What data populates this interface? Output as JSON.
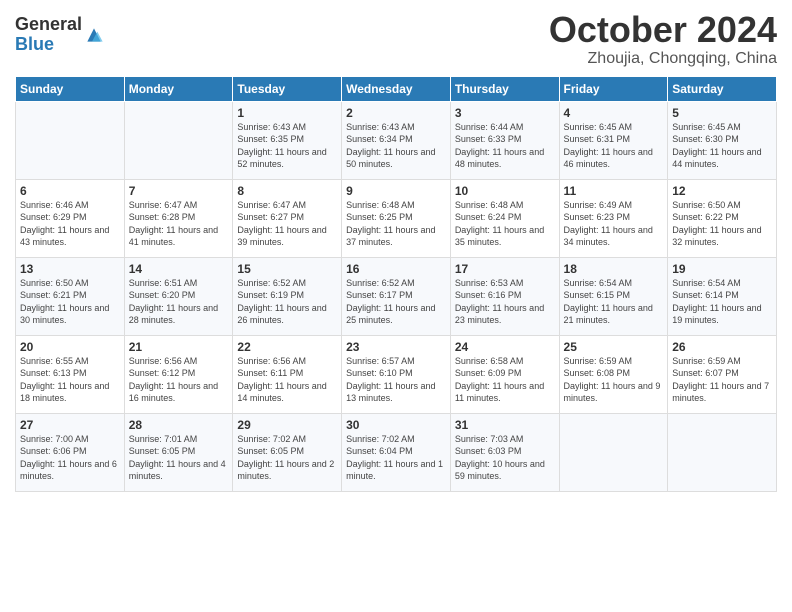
{
  "header": {
    "logo_general": "General",
    "logo_blue": "Blue",
    "title": "October 2024",
    "subtitle": "Zhoujia, Chongqing, China"
  },
  "days_of_week": [
    "Sunday",
    "Monday",
    "Tuesday",
    "Wednesday",
    "Thursday",
    "Friday",
    "Saturday"
  ],
  "weeks": [
    [
      {
        "day": "",
        "info": ""
      },
      {
        "day": "",
        "info": ""
      },
      {
        "day": "1",
        "info": "Sunrise: 6:43 AM\nSunset: 6:35 PM\nDaylight: 11 hours and 52 minutes."
      },
      {
        "day": "2",
        "info": "Sunrise: 6:43 AM\nSunset: 6:34 PM\nDaylight: 11 hours and 50 minutes."
      },
      {
        "day": "3",
        "info": "Sunrise: 6:44 AM\nSunset: 6:33 PM\nDaylight: 11 hours and 48 minutes."
      },
      {
        "day": "4",
        "info": "Sunrise: 6:45 AM\nSunset: 6:31 PM\nDaylight: 11 hours and 46 minutes."
      },
      {
        "day": "5",
        "info": "Sunrise: 6:45 AM\nSunset: 6:30 PM\nDaylight: 11 hours and 44 minutes."
      }
    ],
    [
      {
        "day": "6",
        "info": "Sunrise: 6:46 AM\nSunset: 6:29 PM\nDaylight: 11 hours and 43 minutes."
      },
      {
        "day": "7",
        "info": "Sunrise: 6:47 AM\nSunset: 6:28 PM\nDaylight: 11 hours and 41 minutes."
      },
      {
        "day": "8",
        "info": "Sunrise: 6:47 AM\nSunset: 6:27 PM\nDaylight: 11 hours and 39 minutes."
      },
      {
        "day": "9",
        "info": "Sunrise: 6:48 AM\nSunset: 6:25 PM\nDaylight: 11 hours and 37 minutes."
      },
      {
        "day": "10",
        "info": "Sunrise: 6:48 AM\nSunset: 6:24 PM\nDaylight: 11 hours and 35 minutes."
      },
      {
        "day": "11",
        "info": "Sunrise: 6:49 AM\nSunset: 6:23 PM\nDaylight: 11 hours and 34 minutes."
      },
      {
        "day": "12",
        "info": "Sunrise: 6:50 AM\nSunset: 6:22 PM\nDaylight: 11 hours and 32 minutes."
      }
    ],
    [
      {
        "day": "13",
        "info": "Sunrise: 6:50 AM\nSunset: 6:21 PM\nDaylight: 11 hours and 30 minutes."
      },
      {
        "day": "14",
        "info": "Sunrise: 6:51 AM\nSunset: 6:20 PM\nDaylight: 11 hours and 28 minutes."
      },
      {
        "day": "15",
        "info": "Sunrise: 6:52 AM\nSunset: 6:19 PM\nDaylight: 11 hours and 26 minutes."
      },
      {
        "day": "16",
        "info": "Sunrise: 6:52 AM\nSunset: 6:17 PM\nDaylight: 11 hours and 25 minutes."
      },
      {
        "day": "17",
        "info": "Sunrise: 6:53 AM\nSunset: 6:16 PM\nDaylight: 11 hours and 23 minutes."
      },
      {
        "day": "18",
        "info": "Sunrise: 6:54 AM\nSunset: 6:15 PM\nDaylight: 11 hours and 21 minutes."
      },
      {
        "day": "19",
        "info": "Sunrise: 6:54 AM\nSunset: 6:14 PM\nDaylight: 11 hours and 19 minutes."
      }
    ],
    [
      {
        "day": "20",
        "info": "Sunrise: 6:55 AM\nSunset: 6:13 PM\nDaylight: 11 hours and 18 minutes."
      },
      {
        "day": "21",
        "info": "Sunrise: 6:56 AM\nSunset: 6:12 PM\nDaylight: 11 hours and 16 minutes."
      },
      {
        "day": "22",
        "info": "Sunrise: 6:56 AM\nSunset: 6:11 PM\nDaylight: 11 hours and 14 minutes."
      },
      {
        "day": "23",
        "info": "Sunrise: 6:57 AM\nSunset: 6:10 PM\nDaylight: 11 hours and 13 minutes."
      },
      {
        "day": "24",
        "info": "Sunrise: 6:58 AM\nSunset: 6:09 PM\nDaylight: 11 hours and 11 minutes."
      },
      {
        "day": "25",
        "info": "Sunrise: 6:59 AM\nSunset: 6:08 PM\nDaylight: 11 hours and 9 minutes."
      },
      {
        "day": "26",
        "info": "Sunrise: 6:59 AM\nSunset: 6:07 PM\nDaylight: 11 hours and 7 minutes."
      }
    ],
    [
      {
        "day": "27",
        "info": "Sunrise: 7:00 AM\nSunset: 6:06 PM\nDaylight: 11 hours and 6 minutes."
      },
      {
        "day": "28",
        "info": "Sunrise: 7:01 AM\nSunset: 6:05 PM\nDaylight: 11 hours and 4 minutes."
      },
      {
        "day": "29",
        "info": "Sunrise: 7:02 AM\nSunset: 6:05 PM\nDaylight: 11 hours and 2 minutes."
      },
      {
        "day": "30",
        "info": "Sunrise: 7:02 AM\nSunset: 6:04 PM\nDaylight: 11 hours and 1 minute."
      },
      {
        "day": "31",
        "info": "Sunrise: 7:03 AM\nSunset: 6:03 PM\nDaylight: 10 hours and 59 minutes."
      },
      {
        "day": "",
        "info": ""
      },
      {
        "day": "",
        "info": ""
      }
    ]
  ]
}
